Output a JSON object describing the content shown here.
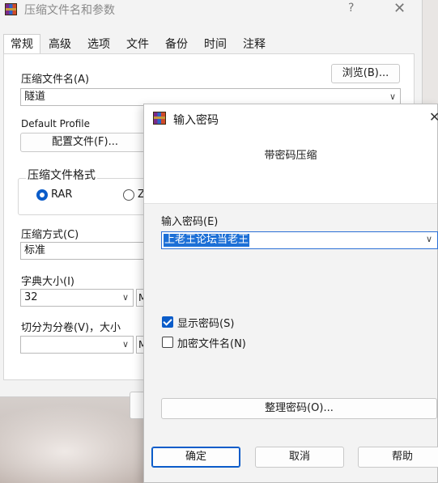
{
  "main_window": {
    "title": "压缩文件名和参数",
    "help": "?",
    "close": "✕",
    "tabs": [
      {
        "label": "常规",
        "active": true
      },
      {
        "label": "高级"
      },
      {
        "label": "选项"
      },
      {
        "label": "文件"
      },
      {
        "label": "备份"
      },
      {
        "label": "时间"
      },
      {
        "label": "注释"
      }
    ],
    "archive_name_label": "压缩文件名(A)",
    "browse_button": "浏览(B)...",
    "archive_name_value": "隧道",
    "default_profile_label": "Default Profile",
    "profiles_button": "配置文件(F)...",
    "format_group_title": "压缩文件格式",
    "format_rar": "RAR",
    "format_zip_partial": "Z",
    "method_label": "压缩方式(C)",
    "method_value": "标准",
    "dict_label": "字典大小(I)",
    "dict_value": "32",
    "dict_unit_partial": "M",
    "split_label": "切分为分卷(V)，大小",
    "split_value": "",
    "split_unit_partial": "M"
  },
  "password_dialog": {
    "title": "输入密码",
    "close": "✕",
    "subtitle": "带密码压缩",
    "enter_password_label": "输入密码(E)",
    "password_value": "上老王论坛当老王",
    "show_password_label": "显示密码(S)",
    "show_password_checked": true,
    "encrypt_names_label": "加密文件名(N)",
    "encrypt_names_checked": false,
    "organize_button": "整理密码(O)...",
    "ok_button": "确定",
    "cancel_button": "取消",
    "help_button": "帮助"
  },
  "colors": {
    "accent": "#0b5cc9",
    "selection": "#1c6fd6"
  }
}
